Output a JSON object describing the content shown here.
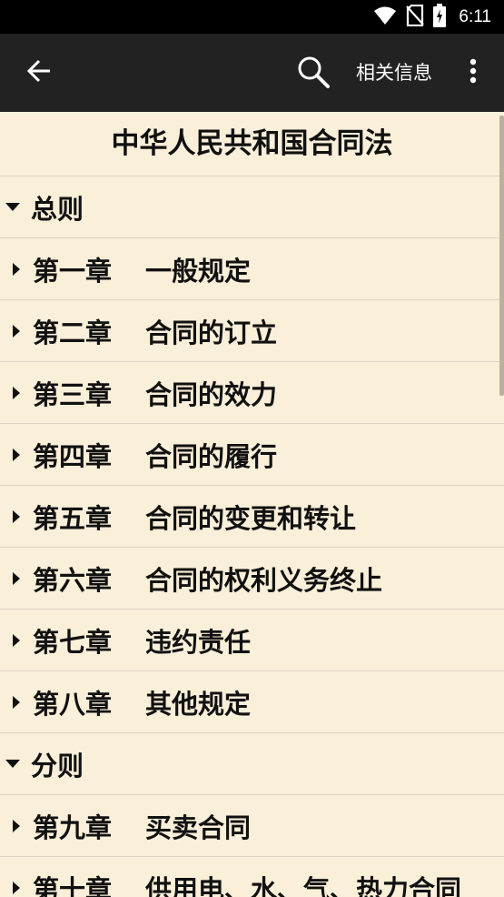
{
  "status_bar": {
    "time": "6:11",
    "icons": [
      "wifi-icon",
      "no-sim-icon",
      "battery-charging-icon"
    ]
  },
  "toolbar": {
    "back_icon": "arrow-left-icon",
    "search_icon": "search-icon",
    "related_label": "相关信息",
    "more_icon": "more-vert-icon"
  },
  "document": {
    "title": "中华人民共和国合同法"
  },
  "toc": [
    {
      "type": "section",
      "label": "总则",
      "expanded": true
    },
    {
      "type": "chapter",
      "num": "第一章",
      "title": "一般规定"
    },
    {
      "type": "chapter",
      "num": "第二章",
      "title": "合同的订立"
    },
    {
      "type": "chapter",
      "num": "第三章",
      "title": "合同的效力"
    },
    {
      "type": "chapter",
      "num": "第四章",
      "title": "合同的履行"
    },
    {
      "type": "chapter",
      "num": "第五章",
      "title": "合同的变更和转让"
    },
    {
      "type": "chapter",
      "num": "第六章",
      "title": "合同的权利义务终止"
    },
    {
      "type": "chapter",
      "num": "第七章",
      "title": "违约责任"
    },
    {
      "type": "chapter",
      "num": "第八章",
      "title": "其他规定"
    },
    {
      "type": "section",
      "label": "分则",
      "expanded": true
    },
    {
      "type": "chapter",
      "num": "第九章",
      "title": "买卖合同"
    },
    {
      "type": "chapter",
      "num": "第十章",
      "title": "供用电、水、气、热力合同"
    }
  ],
  "colors": {
    "background": "#FAEFD9",
    "toolbar": "#222222",
    "status_bar": "#000000",
    "divider": "#DDD4C3"
  }
}
